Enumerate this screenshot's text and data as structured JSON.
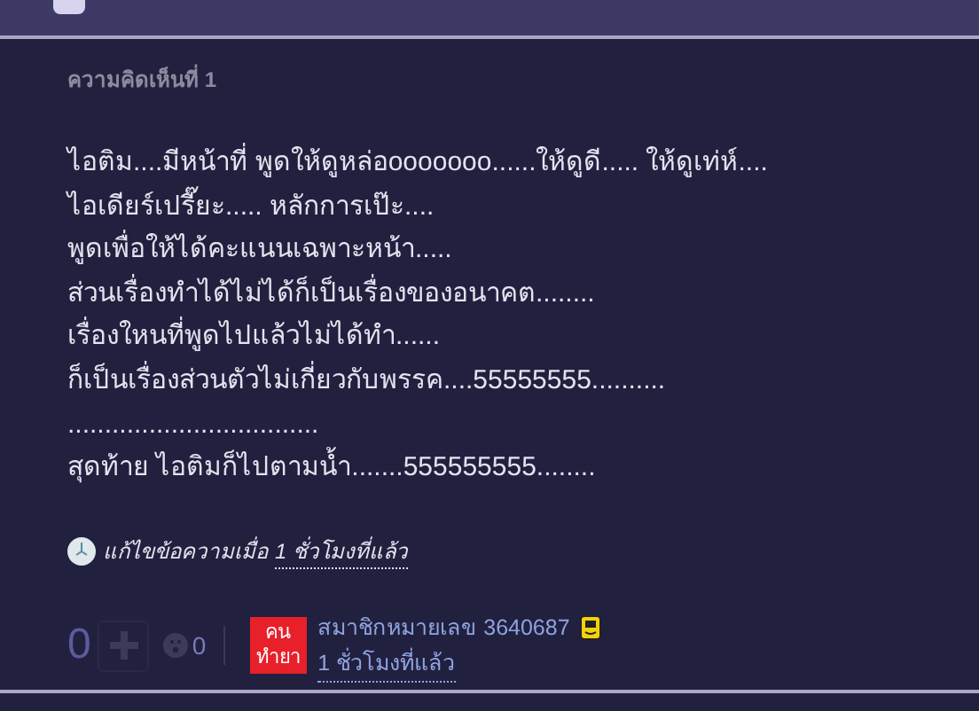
{
  "comment": {
    "heading": "ความคิดเห็นที่ 1",
    "lines": [
      "ไอติม....มีหน้าที่ พูดให้ดูหล่อooooooo......ให้ดูดี..... ให้ดูเท่ห์....",
      "ไอเดียร์เปรี๊ยะ..... หลักการเป๊ะ....",
      "พูดเพื่อให้ได้คะแนนเฉพาะหน้า.....",
      "ส่วนเรื่องทำได้ไม่ได้ก็เป็นเรื่องของอนาคต........",
      "เรื่องใหนที่พูดไปแล้วไม่ได้ทำ......",
      "ก็เป็นเรื่องส่วนตัวไม่เกี่ยวกับพรรค....55555555..........",
      "..................................",
      "สุดท้าย ไอติมก็ไปตามน้ำ.......555555555........"
    ],
    "edit_note": {
      "label": "แก้ไขข้อความเมื่อ",
      "time": "1 ชั่วโมงที่แล้ว"
    },
    "footer": {
      "votes": "0",
      "emotions": "0",
      "badge": [
        "คน",
        "ทำยา"
      ],
      "author": "สมาชิกหมายเลข 3640687",
      "time": "1 ชั่วโมงที่แล้ว"
    }
  }
}
